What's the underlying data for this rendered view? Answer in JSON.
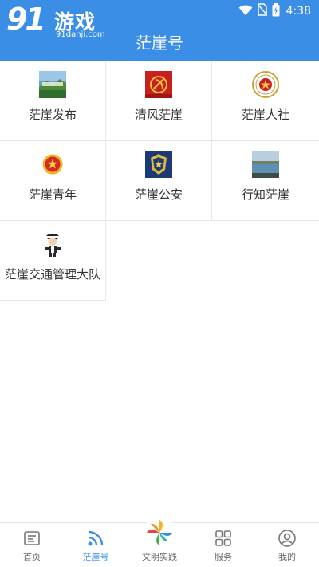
{
  "watermark": {
    "brand_number": "91",
    "brand_text": "游戏",
    "url": "91danji.com"
  },
  "status_bar": {
    "time": "4:38",
    "icons": [
      "wifi-icon",
      "no-sim-icon",
      "battery-charging-icon"
    ]
  },
  "header": {
    "title": "茫崖号",
    "background": "#3b8ee6"
  },
  "tiles": [
    {
      "label": "茫崖发布",
      "icon": "landscape-photo-icon"
    },
    {
      "label": "清风茫崖",
      "icon": "party-emblem-icon"
    },
    {
      "label": "茫崖人社",
      "icon": "hrss-emblem-icon"
    },
    {
      "label": "茫崖青年",
      "icon": "youth-league-emblem-icon"
    },
    {
      "label": "茫崖公安",
      "icon": "police-emblem-icon"
    },
    {
      "label": "行知茫崖",
      "icon": "lake-photo-icon"
    },
    {
      "label": "茫崖交通管理大队",
      "icon": "traffic-police-icon"
    }
  ],
  "bottom_nav": [
    {
      "label": "首页",
      "icon": "home-news-icon",
      "active": false
    },
    {
      "label": "茫崖号",
      "icon": "rss-feed-icon",
      "active": true
    },
    {
      "label": "文明实践",
      "icon": "pinwheel-icon",
      "active": false
    },
    {
      "label": "服务",
      "icon": "grid-apps-icon",
      "active": false
    },
    {
      "label": "我的",
      "icon": "user-profile-icon",
      "active": false
    }
  ],
  "colors": {
    "accent": "#3b8ee6",
    "inactive": "#666666"
  }
}
